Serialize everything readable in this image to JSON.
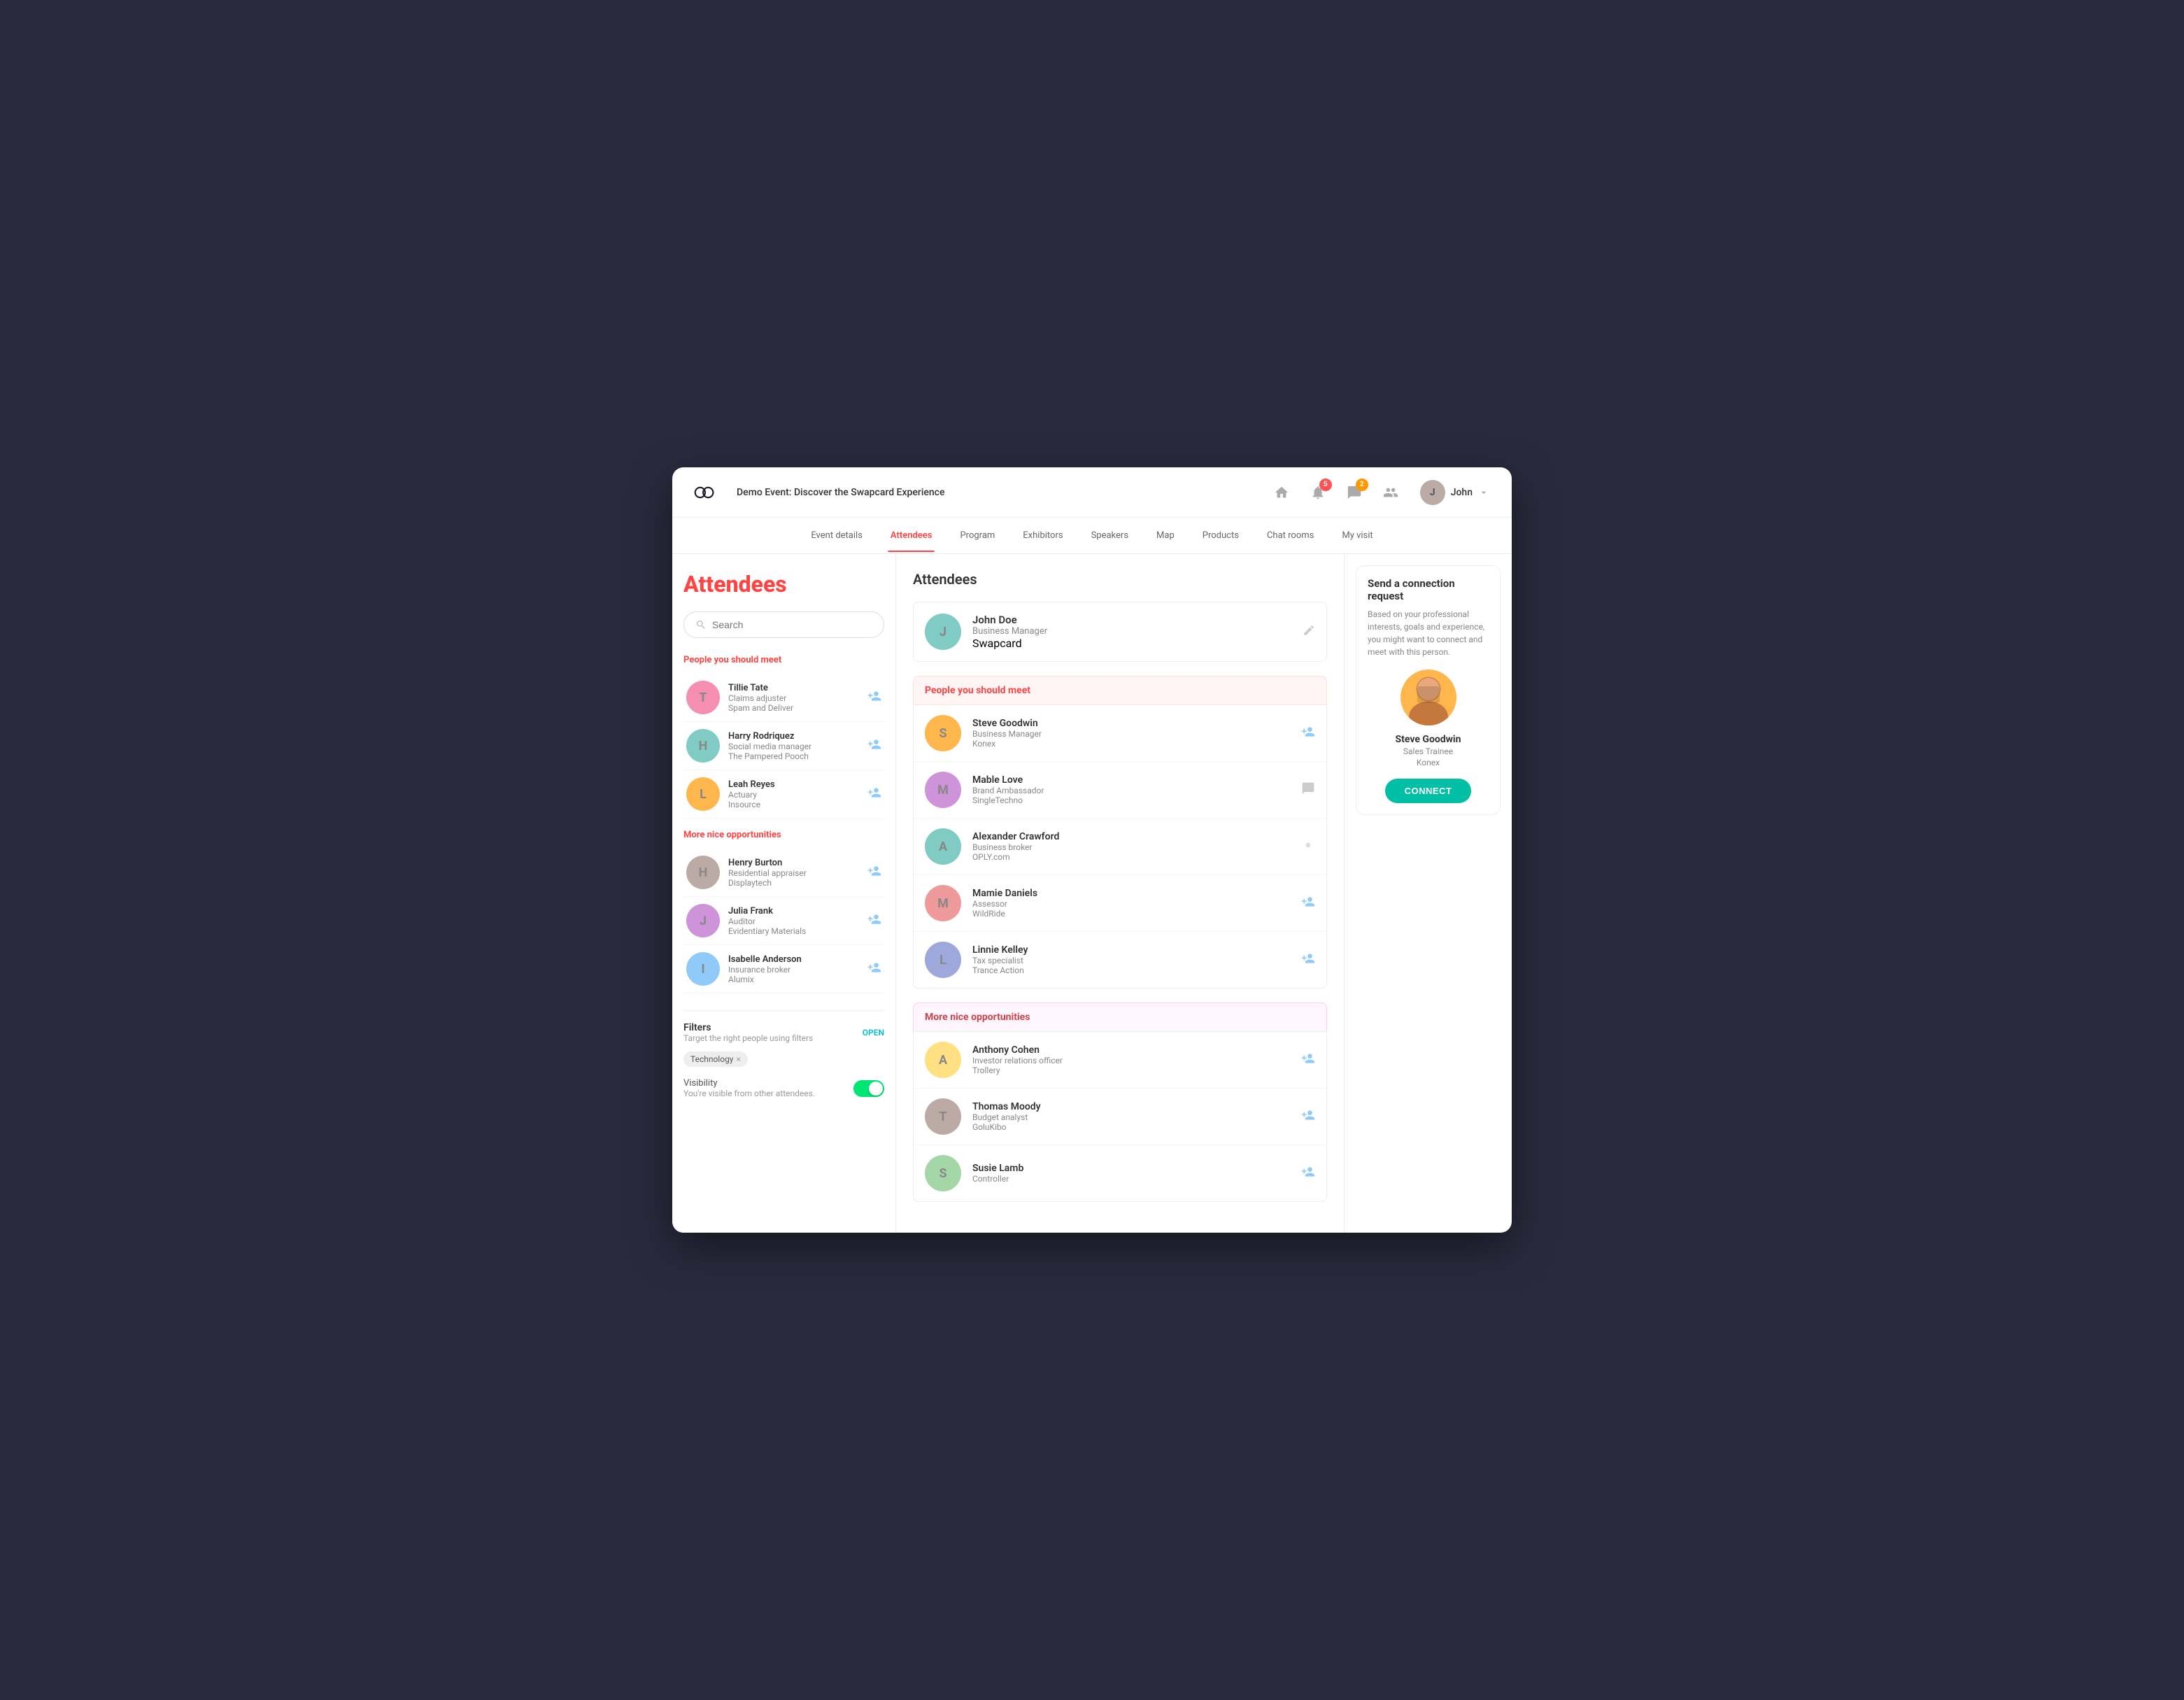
{
  "app": {
    "event_title": "Demo Event: Discover the Swapcard Experience",
    "logo_alt": "Swapcard logo"
  },
  "topbar": {
    "notifications_count": "5",
    "messages_count": "2",
    "user_name": "John"
  },
  "nav": {
    "items": [
      {
        "label": "Event details",
        "active": false
      },
      {
        "label": "Attendees",
        "active": true
      },
      {
        "label": "Program",
        "active": false
      },
      {
        "label": "Exhibitors",
        "active": false
      },
      {
        "label": "Speakers",
        "active": false
      },
      {
        "label": "Map",
        "active": false
      },
      {
        "label": "Products",
        "active": false
      },
      {
        "label": "Chat rooms",
        "active": false
      },
      {
        "label": "My visit",
        "active": false
      }
    ]
  },
  "sidebar": {
    "title": "Attendees",
    "search_placeholder": "Search",
    "section_meet": "People you should meet",
    "section_more": "More nice opportunities",
    "people_meet": [
      {
        "name": "Tillie Tate",
        "role": "Claims adjuster",
        "company": "Spam and Deliver",
        "av_class": "av-pink"
      },
      {
        "name": "Harry Rodriquez",
        "role": "Social media manager",
        "company": "The Pampered Pooch",
        "av_class": "av-teal"
      },
      {
        "name": "Leah Reyes",
        "role": "Actuary",
        "company": "Insource",
        "av_class": "av-orange"
      }
    ],
    "people_more": [
      {
        "name": "Henry Burton",
        "role": "Residential appraiser",
        "company": "Displaytech",
        "av_class": "av-brown"
      },
      {
        "name": "Julia Frank",
        "role": "Auditor",
        "company": "Evidentiary Materials",
        "av_class": "av-purple"
      },
      {
        "name": "Isabelle Anderson",
        "role": "Insurance broker",
        "company": "Alumix",
        "av_class": "av-blue"
      }
    ],
    "filters": {
      "title": "Filters",
      "subtitle": "Target the right people using filters",
      "open_label": "OPEN",
      "tag": "Technology",
      "visibility_label": "Visibility",
      "visibility_sub": "You're visible from other attendees."
    }
  },
  "center": {
    "title": "Attendees",
    "current_user": {
      "name": "John Doe",
      "role": "Business Manager",
      "company": "Swapcard"
    },
    "section_meet": "People you should meet",
    "section_more": "More nice opportunities",
    "people_meet": [
      {
        "name": "Steve Goodwin",
        "role": "Business Manager",
        "company": "Konex",
        "av_class": "av-orange",
        "action": "add"
      },
      {
        "name": "Mable Love",
        "role": "Brand Ambassador",
        "company": "SingleTechno",
        "av_class": "av-purple",
        "action": "msg"
      },
      {
        "name": "Alexander Crawford",
        "role": "Business broker",
        "company": "OPLY.com",
        "av_class": "av-teal",
        "action": "dot"
      },
      {
        "name": "Mamie Daniels",
        "role": "Assessor",
        "company": "WildRide",
        "av_class": "av-red",
        "action": "add"
      },
      {
        "name": "Linnie Kelley",
        "role": "Tax specialist",
        "company": "Trance Action",
        "av_class": "av-indigo",
        "action": "add"
      }
    ],
    "people_more": [
      {
        "name": "Anthony Cohen",
        "role": "Investor relations officer",
        "company": "Trollery",
        "av_class": "av-amber",
        "action": "add"
      },
      {
        "name": "Thomas Moody",
        "role": "Budget analyst",
        "company": "GoluKibo",
        "av_class": "av-brown",
        "action": "add"
      },
      {
        "name": "Susie Lamb",
        "role": "Controller",
        "company": "",
        "av_class": "av-green",
        "action": "add"
      }
    ]
  },
  "connection_request": {
    "title": "Send a connection request",
    "desc": "Based on your professional interests, goals and experience, you might want to connect and meet with this person.",
    "person_name": "Steve Goodwin",
    "person_role": "Sales Trainee",
    "person_company": "Konex",
    "connect_label": "CONNECT"
  }
}
